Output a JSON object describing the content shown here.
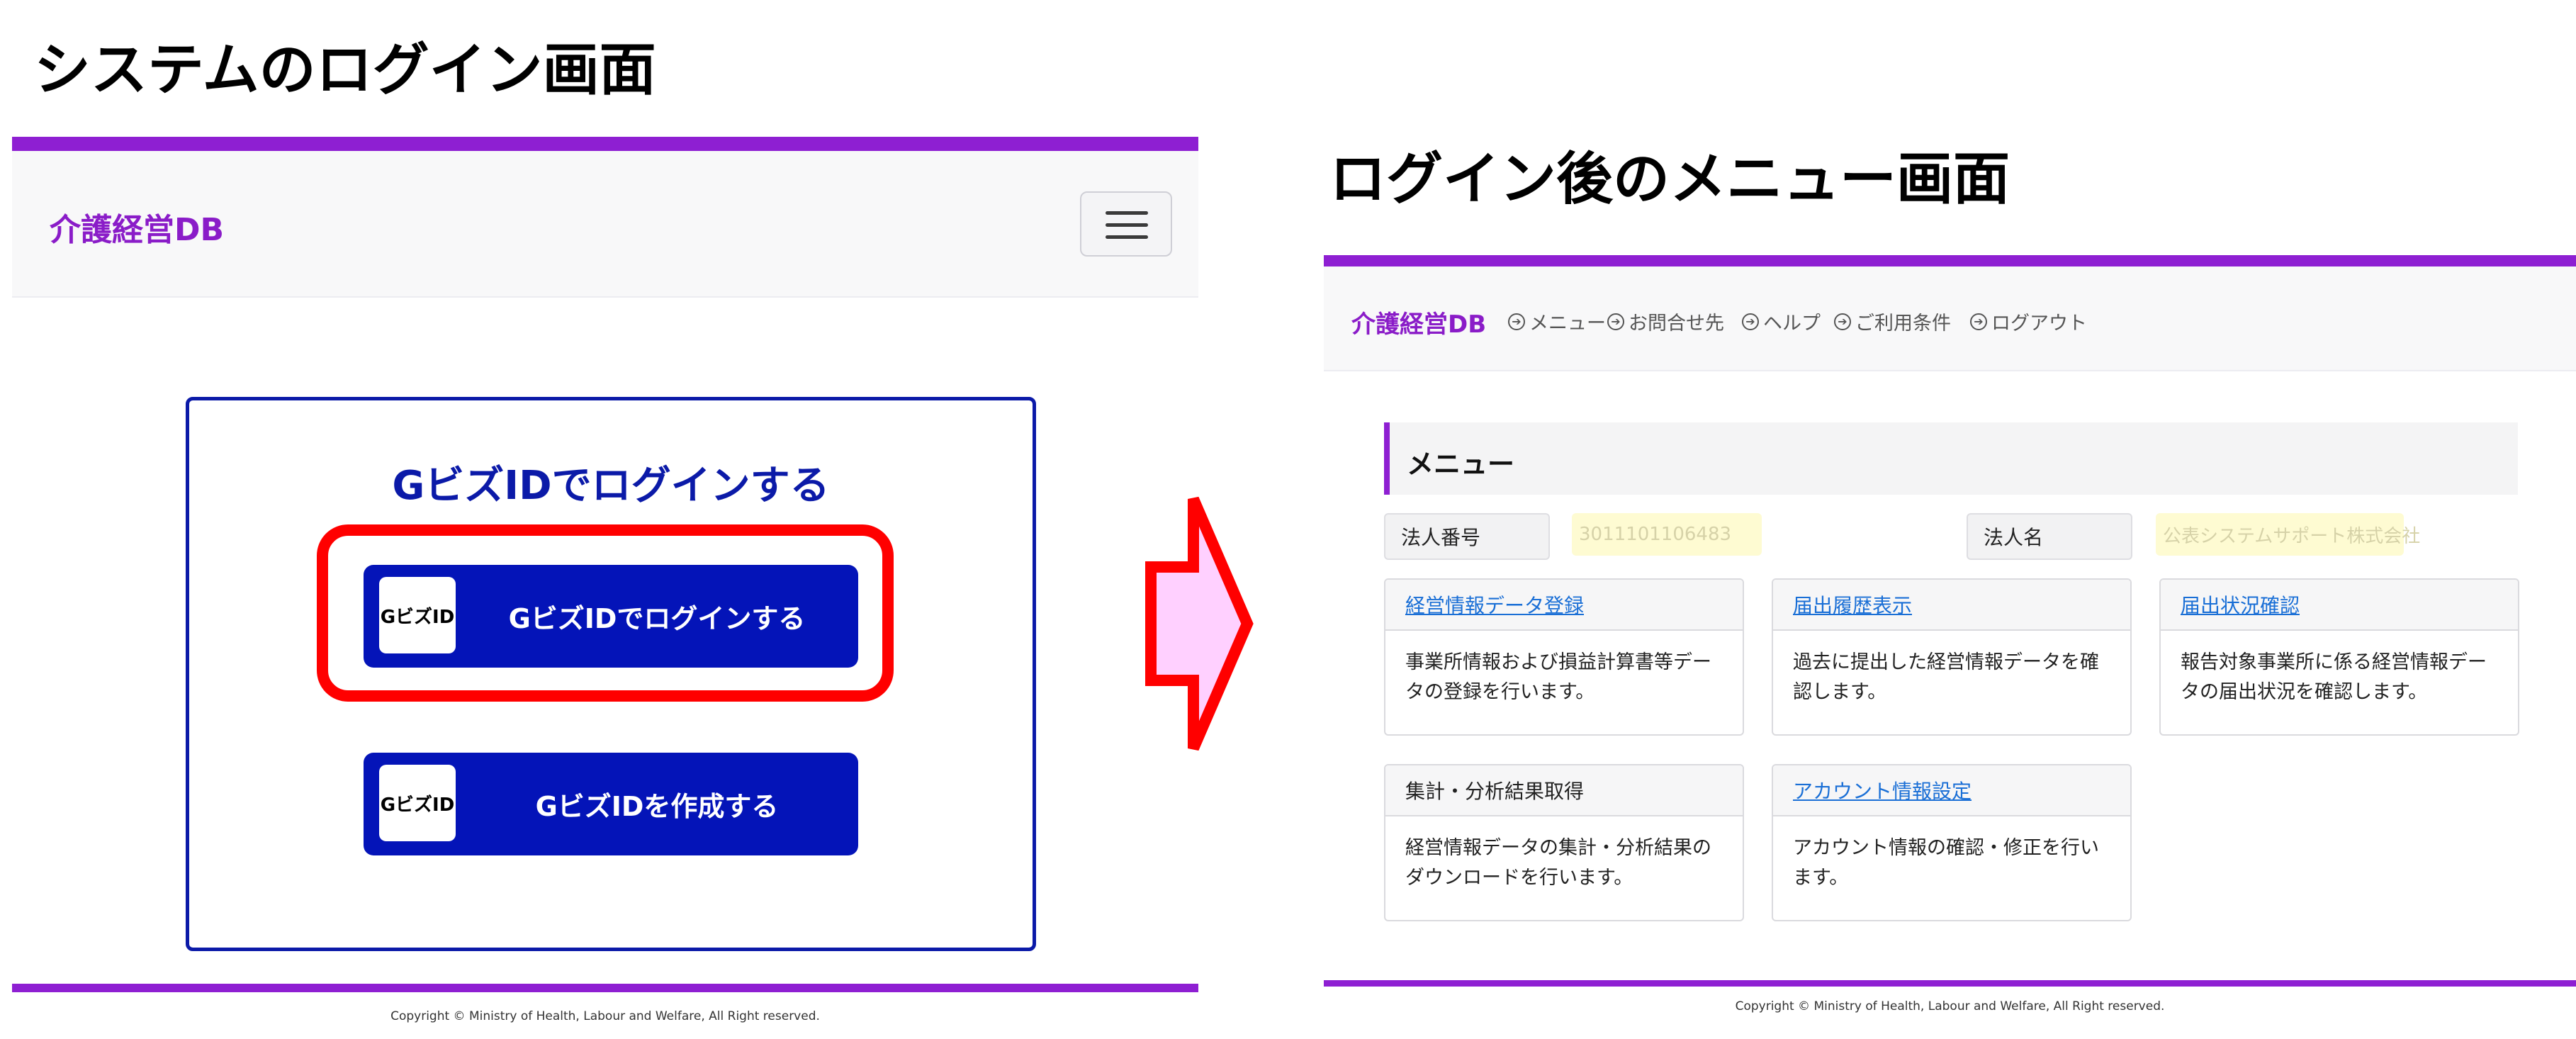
{
  "slide": {
    "left_title": "システムのログイン画面",
    "right_title": "ログイン後のメニュー画面"
  },
  "login_screen": {
    "brand": "介護経営DB",
    "heading": "GビズIDでログインする",
    "login_button": {
      "logo": "GビズID",
      "label": "GビズIDでログインする"
    },
    "create_button": {
      "logo": "GビズID",
      "label": "GビズIDを作成する"
    },
    "copyright": "Copyright © Ministry of Health, Labour and Welfare, All Right reserved."
  },
  "menu_screen": {
    "brand": "介護経営DB",
    "nav": [
      {
        "label": "メニュー",
        "icon": "arrow-circle-right-icon"
      },
      {
        "label": "お問合せ先",
        "icon": "arrow-circle-right-icon"
      },
      {
        "label": "ヘルプ",
        "icon": "arrow-circle-right-icon"
      },
      {
        "label": "ご利用条件",
        "icon": "arrow-circle-right-icon"
      },
      {
        "label": "ログアウト",
        "icon": "arrow-circle-right-icon"
      }
    ],
    "section_title": "メニュー",
    "corp_number": {
      "label": "法人番号",
      "value": "3011101106483"
    },
    "corp_name": {
      "label": "法人名",
      "value": "公表システムサポート株式会社"
    },
    "cards": [
      {
        "title": "経営情報データ登録",
        "link": true,
        "body": "事業所情報および損益計算書等データの登録を行います。"
      },
      {
        "title": "届出履歴表示",
        "link": true,
        "body": "過去に提出した経営情報データを確認します。"
      },
      {
        "title": "届出状況確認",
        "link": true,
        "body": "報告対象事業所に係る経営情報データの届出状況を確認します。"
      },
      {
        "title": "集計・分析結果取得",
        "link": false,
        "body": "経営情報データの集計・分析結果のダウンロードを行います。"
      },
      {
        "title": "アカウント情報設定",
        "link": true,
        "body": "アカウント情報の確認・修正を行います。"
      }
    ],
    "copyright": "Copyright © Ministry of Health, Labour and Welfare, All Right reserved."
  },
  "colors": {
    "brand_purple": "#8e1fd2",
    "gbiz_blue": "#0414b8",
    "highlight_red": "#ff0000",
    "arrow_fill": "#ffd0ff",
    "link_blue": "#1a6fd6"
  }
}
